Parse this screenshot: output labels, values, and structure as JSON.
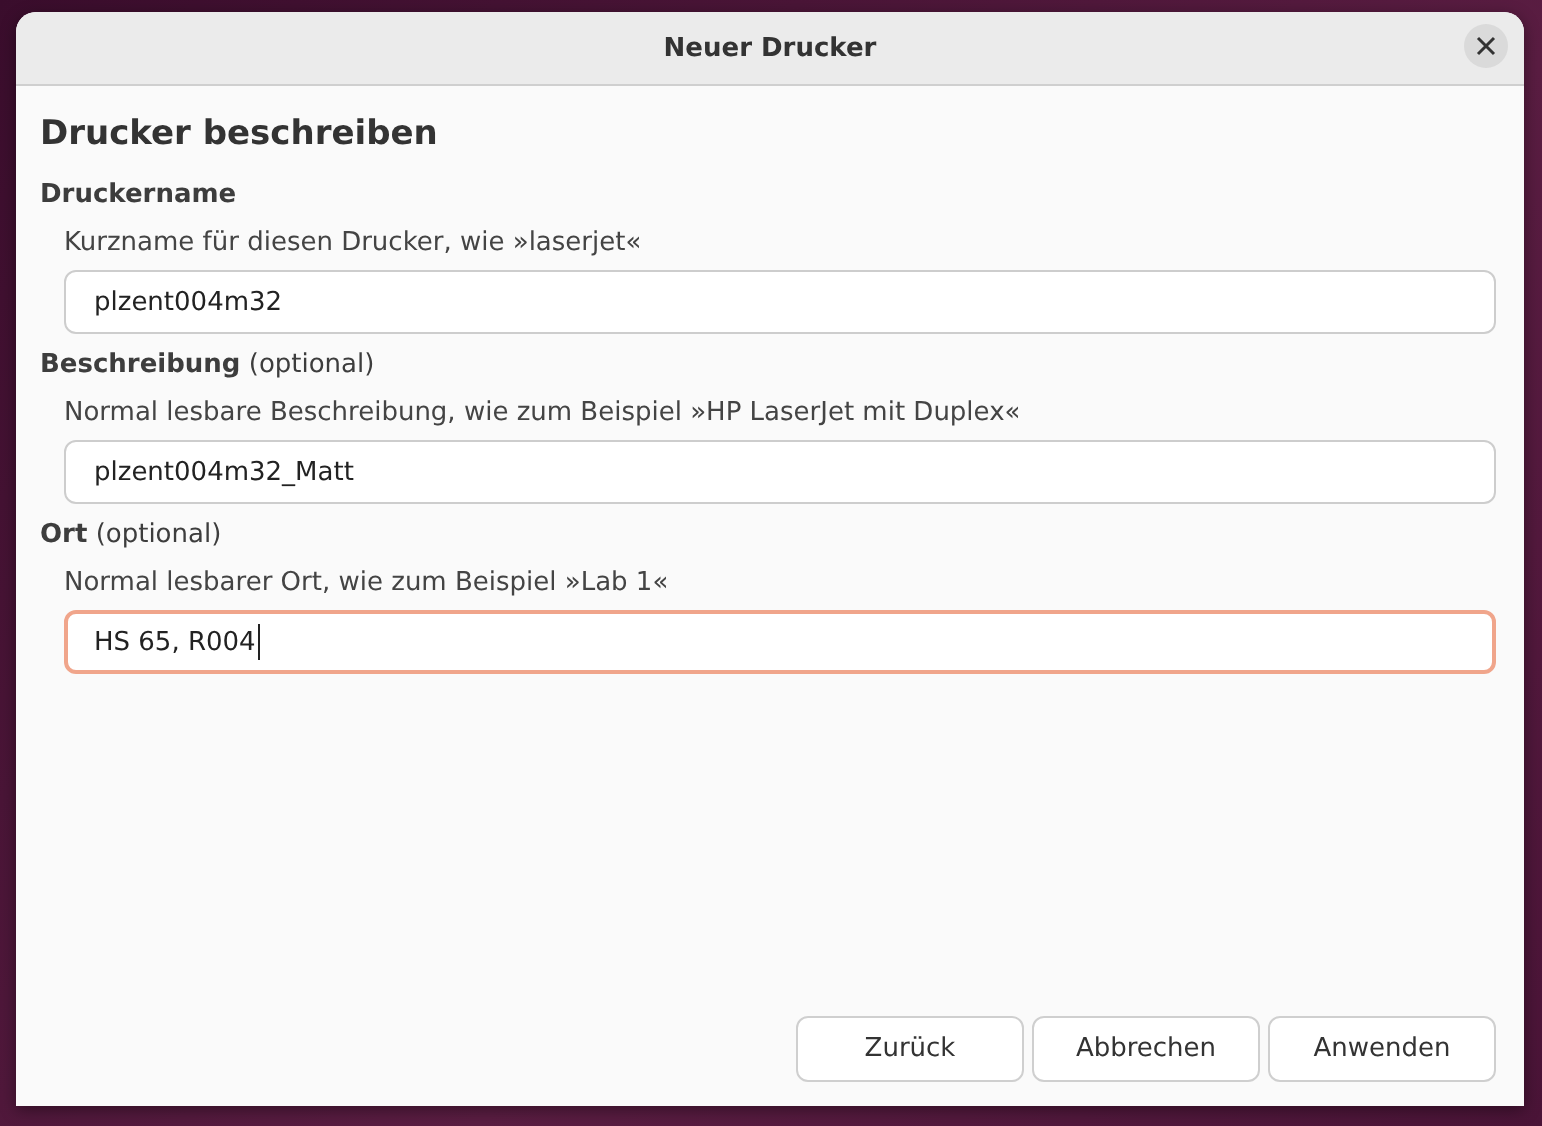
{
  "window": {
    "title": "Neuer Drucker"
  },
  "heading": "Drucker beschreiben",
  "fields": [
    {
      "label": "Druckername",
      "entry": {
        "hint": "Kurzname für diesen Drucker, wie »laserjet«",
        "value": "plzent004m32",
        "focused": false
      }
    },
    {
      "label": "**Beschreibung** (optional)",
      "entry": {
        "hint": "Normal lesbare Beschreibung, wie zum Beispiel »HP LaserJet mit Duplex«",
        "value": "plzent004m32_Matt",
        "focused": false
      }
    },
    {
      "label": "**Ort** (optional)",
      "entry": {
        "hint": "Normal lesbarer Ort, wie zum Beispiel »Lab 1«",
        "value": "HS 65, R004",
        "focused": true
      }
    }
  ],
  "buttons": [
    "Zurück",
    "Abbrechen",
    "Anwenden"
  ]
}
